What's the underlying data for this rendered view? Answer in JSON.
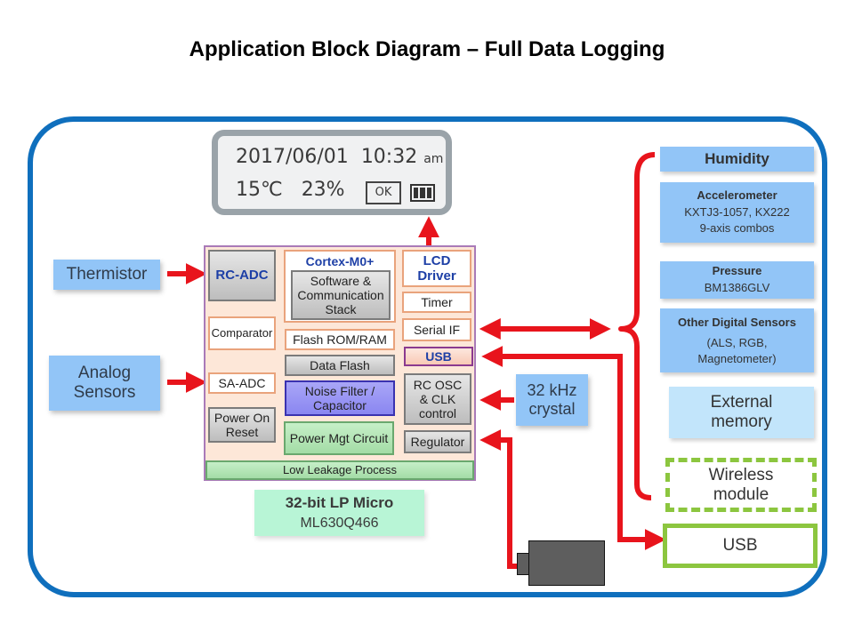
{
  "title": "Application Block Diagram – Full Data Logging",
  "lcd": {
    "date": "2017/06/01",
    "time": "10:32",
    "ampm": "am",
    "temperature": "15℃",
    "humidity": "23%",
    "ok_label": "OK",
    "battery_icon": "battery-full-icon"
  },
  "inputs": {
    "thermistor": "Thermistor",
    "analog_line1": "Analog",
    "analog_line2": "Sensors",
    "crystal_line1": "32 kHz",
    "crystal_line2": "crystal"
  },
  "micro": {
    "rc_adc": "RC-ADC",
    "cortex": "Cortex-M0+",
    "software_line1": "Software &",
    "software_line2": "Communication",
    "software_line3": "Stack",
    "lcd_driver_line1": "LCD",
    "lcd_driver_line2": "Driver",
    "timer": "Timer",
    "comparator": "Comparator",
    "flash": "Flash ROM/RAM",
    "serial_if": "Serial IF",
    "data_flash": "Data Flash",
    "usb": "USB",
    "sa_adc": "SA-ADC",
    "noise_line1": "Noise Filter /",
    "noise_line2": "Capacitor",
    "rcosc_line1": "RC OSC",
    "rcosc_line2": "& CLK",
    "rcosc_line3": "control",
    "por_line1": "Power On",
    "por_line2": "Reset",
    "power_mgt": "Power Mgt Circuit",
    "regulator": "Regulator",
    "low_leakage": "Low Leakage Process",
    "label_line1": "32-bit LP Micro",
    "label_line2": "ML630Q466"
  },
  "peripherals": {
    "humidity": "Humidity",
    "accel_title": "Accelerometer",
    "accel_line1": "KXTJ3-1057,  KX222",
    "accel_line2": "9-axis  combos",
    "pressure_title": "Pressure",
    "pressure_line1": "BM1386GLV",
    "other_title": "Other Digital  Sensors",
    "other_line1": "(ALS,  RGB,",
    "other_line2": "Magnetometer)",
    "ext_mem_line1": "External",
    "ext_mem_line2": "memory",
    "wireless_line1": "Wireless",
    "wireless_line2": "module",
    "usb": "USB"
  },
  "colors": {
    "frame": "#0f6fbd",
    "arrow": "#e8141c",
    "sensor_blue": "#92c5f7",
    "green_outline": "#8cc63f"
  }
}
